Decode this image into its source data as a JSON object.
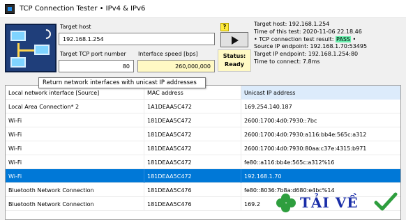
{
  "window": {
    "title": "TCP Connection Tester • IPv4 & IPv6"
  },
  "form": {
    "target_host_label": "Target host",
    "target_host_value": "192.168.1.254",
    "port_label": "Target TCP port number",
    "port_value": "80",
    "speed_label": "Interface speed [bps]",
    "speed_value": "260,000,000",
    "help_label": "?",
    "status_label": "Status:",
    "status_value": "Ready"
  },
  "info": {
    "target_host_line": "Target host: 192.168.1.254",
    "time_line": "Time of this test: 2020-11-06 22.18.46",
    "result_prefix": "• TCP connection test result: ",
    "result_value": "PASS",
    "result_suffix": " •",
    "source_line": "Source IP endpoint: 192.168.1.70:53495",
    "target_ep_line": "Target IP endpoint: 192.168.1.254:80",
    "time_to_connect_line": "Time to connect: 7.8ms"
  },
  "tooltip": {
    "text": "Return network interfaces with unicast IP addresses"
  },
  "table": {
    "headers": [
      "Local network interface [Source]",
      "MAC address",
      "Unicast IP address"
    ],
    "rows": [
      [
        "Local Area Connection* 2",
        "1A1DEAA5C472",
        "169.254.140.187"
      ],
      [
        "Wi-Fi",
        "181DEAA5C472",
        "2600:1700:4d0:7930::7bc"
      ],
      [
        "Wi-Fi",
        "181DEAA5C472",
        "2600:1700:4d0:7930:a116:bb4e:565c:a312"
      ],
      [
        "Wi-Fi",
        "181DEAA5C472",
        "2600:1700:4d0:7930:80aa:c37e:4315:b971"
      ],
      [
        "Wi-Fi",
        "181DEAA5C472",
        "fe80::a116:bb4e:565c:a312%16"
      ],
      [
        "Wi-Fi",
        "181DEAA5C472",
        "192.168.1.70"
      ],
      [
        "Bluetooth Network Connection",
        "181DEAA5C476",
        "fe80::8036:7b8a:d680:e4bc%14"
      ],
      [
        "Bluetooth Network Connection",
        "181DEAA5C476",
        "169.2"
      ]
    ],
    "selected_row": 5
  },
  "watermark": {
    "text": "TẢI VỀ"
  },
  "colors": {
    "selection": "#0078d7",
    "pass_highlight": "#69f0ae",
    "status_bg": "#fff9c4",
    "help_bg": "#ffeb3b"
  }
}
